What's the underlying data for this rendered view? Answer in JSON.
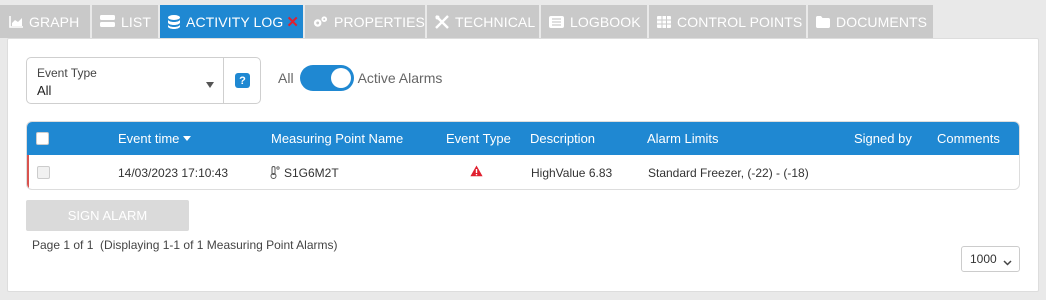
{
  "tabs": [
    {
      "label": "GRAPH",
      "icon": "area-chart-icon"
    },
    {
      "label": "LIST",
      "icon": "list-icon"
    },
    {
      "label": "ACTIVITY LOG",
      "icon": "database-icon",
      "active": true
    },
    {
      "label": "PROPERTIES",
      "icon": "gears-icon"
    },
    {
      "label": "TECHNICAL",
      "icon": "wrench-icon"
    },
    {
      "label": "LOGBOOK",
      "icon": "logbook-icon"
    },
    {
      "label": "CONTROL POINTS",
      "icon": "table-icon"
    },
    {
      "label": "DOCUMENTS",
      "icon": "folder-icon"
    }
  ],
  "filter": {
    "label": "Event Type",
    "value": "All",
    "help": "?"
  },
  "toggle": {
    "left_label": "All",
    "right_label": "Active Alarms",
    "state": "Active Alarms"
  },
  "table": {
    "columns": [
      "Event time",
      "Measuring Point Name",
      "Event Type",
      "Description",
      "Alarm Limits",
      "Signed by",
      "Comments"
    ],
    "rows": [
      {
        "event_time": "14/03/2023 17:10:43",
        "measuring_point": "S1G6M2T",
        "event_type_icon": "warning-triangle-icon",
        "description": "HighValue 6.83",
        "alarm_limits": "Standard Freezer, (-22) - (-18)",
        "signed_by": "",
        "comments": ""
      }
    ]
  },
  "sign_button": "SIGN ALARM",
  "pager_info": "Page 1 of 1  (Displaying 1-1 of 1 Measuring Point Alarms)",
  "page_size": "1000",
  "colors": {
    "accent": "#1f88d2",
    "inactive_tab": "#c9c9c9",
    "alarm": "#e0202f"
  }
}
